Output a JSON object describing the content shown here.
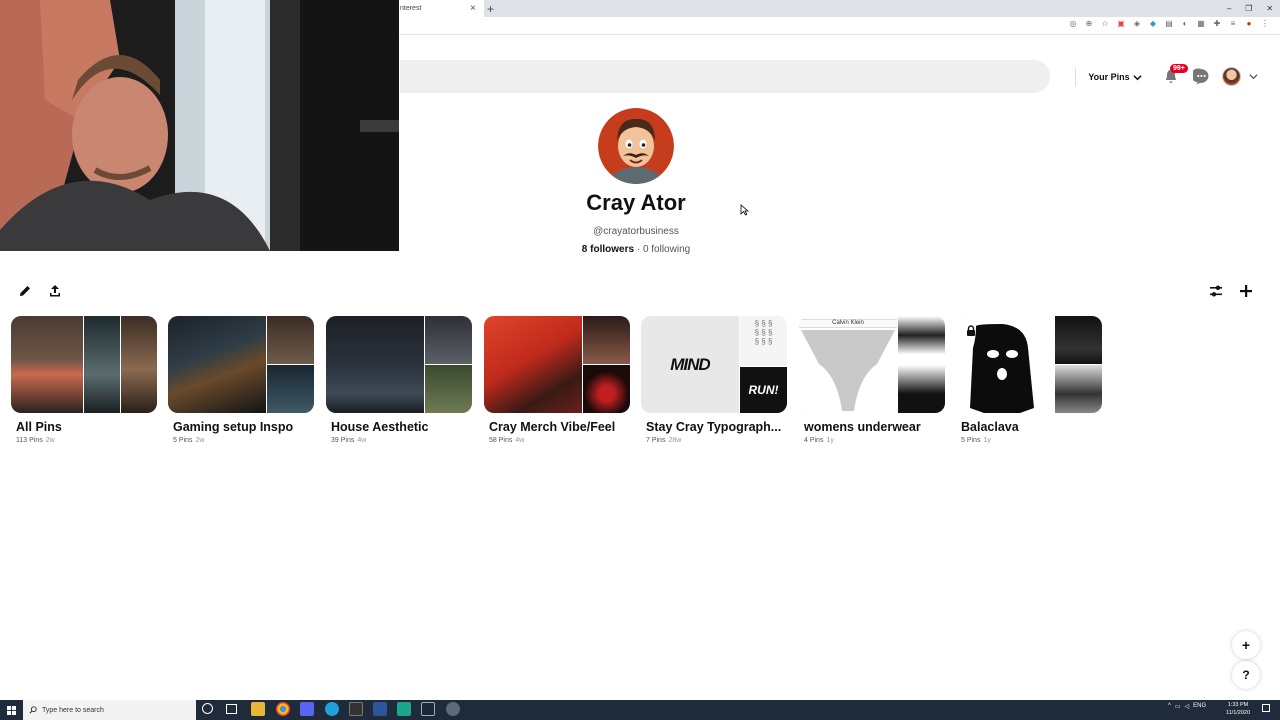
{
  "browser": {
    "tab_title": "nterest",
    "tab_close": "×",
    "new_tab": "+",
    "window_controls": [
      "–",
      "❐",
      "✕"
    ]
  },
  "header": {
    "your_pins_label": "Your Pins",
    "notification_badge": "99+"
  },
  "profile": {
    "name": "Cray Ator",
    "handle": "@crayatorbusiness",
    "followers": "8 followers",
    "following": "0 following"
  },
  "boards": [
    {
      "title": "All Pins",
      "pins": "113 Pins",
      "age": "2w"
    },
    {
      "title": "Gaming setup Inspo",
      "pins": "5 Pins",
      "age": "2w"
    },
    {
      "title": "House Aesthetic",
      "pins": "39 Pins",
      "age": "4w"
    },
    {
      "title": "Cray Merch Vibe/Feel",
      "pins": "58 Pins",
      "age": "4w"
    },
    {
      "title": "Stay Cray Typograph...",
      "pins": "7 Pins",
      "age": "28w"
    },
    {
      "title": "womens underwear",
      "pins": "4 Pins",
      "age": "1y"
    },
    {
      "title": "Balaclava",
      "pins": "5 Pins",
      "age": "1y"
    }
  ],
  "cover_text": {
    "mind": "MIND",
    "run": "RUN!",
    "calvin": "Calvin Klein"
  },
  "floating": {
    "add": "+",
    "help": "?"
  },
  "taskbar": {
    "search_placeholder": "Type here to search",
    "lang": "ENG",
    "time": "1:33 PM",
    "date": "11/1/2020"
  },
  "colors": {
    "brand_red": "#e60023",
    "taskbar": "#1f2a3a"
  }
}
